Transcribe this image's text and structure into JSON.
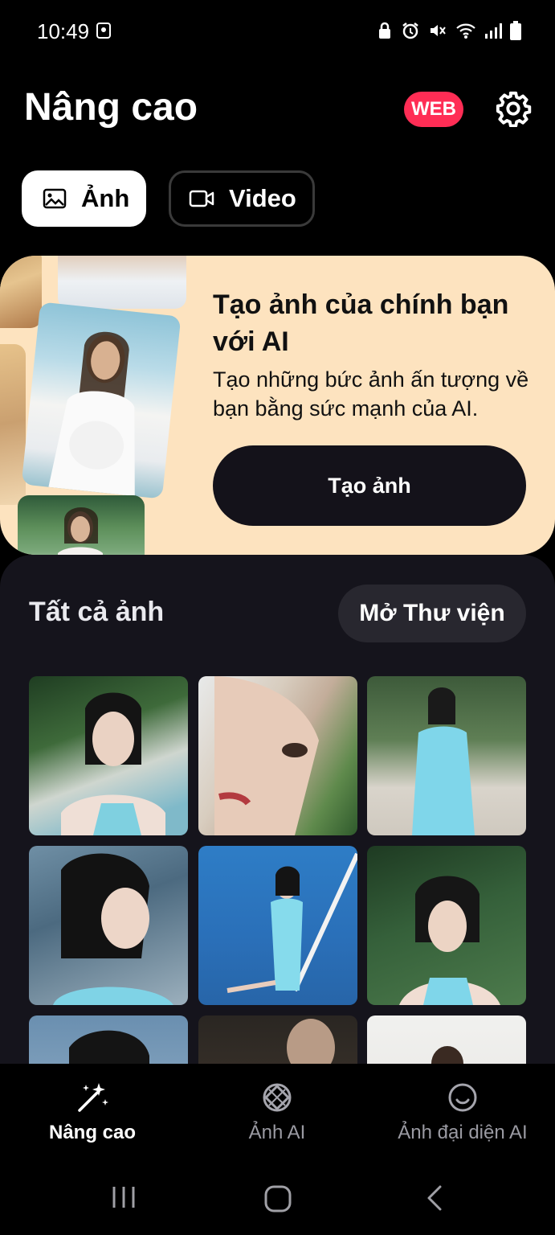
{
  "status_bar": {
    "time": "10:49"
  },
  "header": {
    "title": "Nâng cao",
    "web_badge": "WEB"
  },
  "tabs": [
    {
      "label": "Ảnh",
      "icon": "image-icon",
      "active": true
    },
    {
      "label": "Video",
      "icon": "video-icon",
      "active": false
    }
  ],
  "promo": {
    "title": "Tạo ảnh của chính bạn với AI",
    "description": "Tạo những bức ảnh ấn tượng về bạn bằng sức mạnh của AI.",
    "button_label": "Tạo ảnh"
  },
  "gallery": {
    "title": "Tất cả ảnh",
    "open_library_label": "Mở Thư viện"
  },
  "bottom_nav": [
    {
      "label": "Nâng cao",
      "icon": "magic-wand-icon",
      "active": true
    },
    {
      "label": "Ảnh AI",
      "icon": "aperture-icon",
      "active": false
    },
    {
      "label": "Ảnh đại diện AI",
      "icon": "smiley-face-icon",
      "active": false
    }
  ],
  "colors": {
    "accent_web": "#ff2d55",
    "promo_bg": "#fde3bf",
    "promo_button": "#14121a",
    "gallery_bg": "#15141c"
  }
}
